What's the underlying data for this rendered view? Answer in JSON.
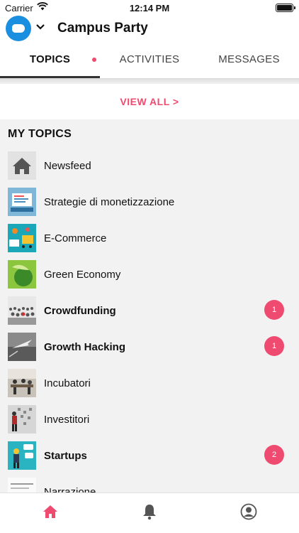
{
  "status_bar": {
    "carrier": "Carrier",
    "time": "12:14 PM"
  },
  "header": {
    "title": "Campus Party"
  },
  "tabs": [
    {
      "label": "TOPICS",
      "active": true
    },
    {
      "label": "ACTIVITIES",
      "active": false
    },
    {
      "label": "MESSAGES",
      "active": false
    }
  ],
  "view_all": "VIEW ALL >",
  "section_title": "MY TOPICS",
  "topics": [
    {
      "label": "Newsfeed",
      "bold": false,
      "badge": ""
    },
    {
      "label": "Strategie di monetizzazione",
      "bold": false,
      "badge": ""
    },
    {
      "label": "E-Commerce",
      "bold": false,
      "badge": ""
    },
    {
      "label": "Green Economy",
      "bold": false,
      "badge": ""
    },
    {
      "label": "Crowdfunding",
      "bold": true,
      "badge": "1"
    },
    {
      "label": "Growth Hacking",
      "bold": true,
      "badge": "1"
    },
    {
      "label": "Incubatori",
      "bold": false,
      "badge": ""
    },
    {
      "label": "Investitori",
      "bold": false,
      "badge": ""
    },
    {
      "label": "Startups",
      "bold": true,
      "badge": "2"
    },
    {
      "label": "Narrazione",
      "bold": false,
      "badge": ""
    }
  ],
  "colors": {
    "accent": "#ef4a6f",
    "logo": "#1a8fe0"
  }
}
